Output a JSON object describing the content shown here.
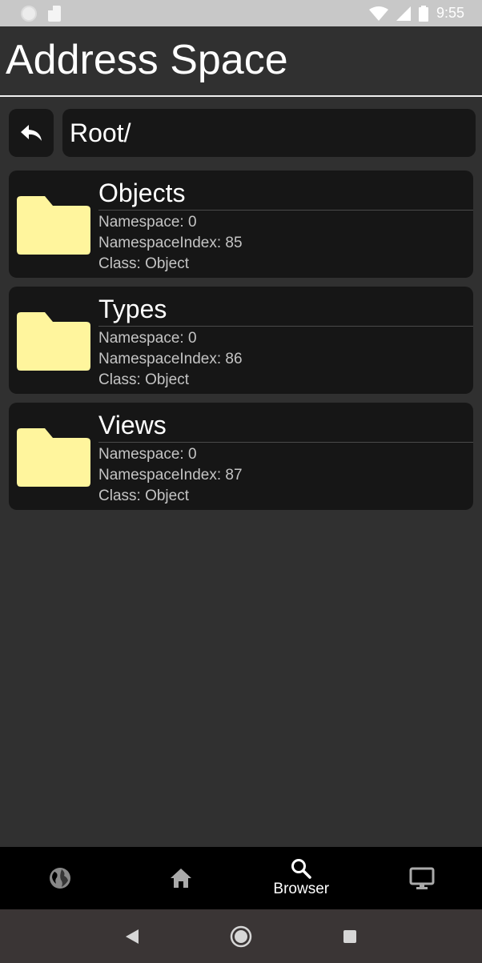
{
  "status_bar": {
    "time": "9:55"
  },
  "app_bar": {
    "title": "Address Space"
  },
  "path": {
    "current": "Root/"
  },
  "nodes": [
    {
      "title": "Objects",
      "namespace": "Namespace: 0",
      "namespace_index": "NamespaceIndex: 85",
      "class": "Class: Object"
    },
    {
      "title": "Types",
      "namespace": "Namespace: 0",
      "namespace_index": "NamespaceIndex: 86",
      "class": "Class: Object"
    },
    {
      "title": "Views",
      "namespace": "Namespace: 0",
      "namespace_index": "NamespaceIndex: 87",
      "class": "Class: Object"
    }
  ],
  "bottom_nav": {
    "items": [
      {
        "icon": "globe-icon",
        "label": ""
      },
      {
        "icon": "home-icon",
        "label": ""
      },
      {
        "icon": "search-icon",
        "label": "Browser"
      },
      {
        "icon": "monitor-icon",
        "label": ""
      }
    ],
    "active": "Browser"
  },
  "colors": {
    "background": "#303030",
    "card": "#161616",
    "folder": "#fff59d",
    "status_bar": "#c8c8c8",
    "bottom_nav": "#000000"
  }
}
